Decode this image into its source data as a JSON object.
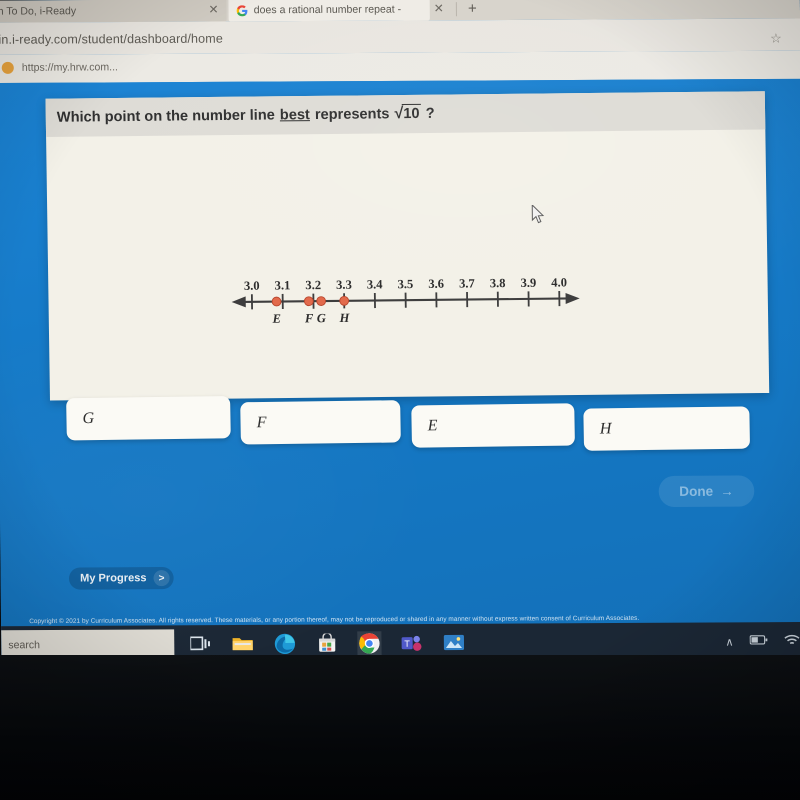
{
  "browser": {
    "tabs": [
      {
        "title": "Math To Do, i-Ready",
        "favicon": "iready-icon",
        "active": false
      },
      {
        "title": "does a rational number repeat -",
        "favicon": "google-g-icon",
        "active": true
      }
    ],
    "new_tab_label": "+",
    "close_label": "✕",
    "url": "gin.i-ready.com/student/dashboard/home",
    "bookmark_star": "☆",
    "bookmarks": [
      {
        "label": "https://my.hrw.com...",
        "favicon": "orange-dot-icon"
      }
    ]
  },
  "question": {
    "prefix": "Which point on the number line",
    "emphasis": "best",
    "middle": "represents",
    "radical_sign": "√",
    "radicand": "10",
    "suffix": "?"
  },
  "number_line": {
    "tick_labels": [
      "3.0",
      "3.1",
      "3.2",
      "3.3",
      "3.4",
      "3.5",
      "3.6",
      "3.7",
      "3.8",
      "3.9",
      "4.0"
    ],
    "tick_values": [
      3.0,
      3.1,
      3.2,
      3.3,
      3.4,
      3.5,
      3.6,
      3.7,
      3.8,
      3.9,
      4.0
    ],
    "axis_min": 2.96,
    "axis_max": 4.04,
    "left_arrow": true,
    "right_arrow": true,
    "point_color": "#e2694a",
    "axis_color": "#3c3c3c",
    "points": [
      {
        "label": "E",
        "value": 3.08
      },
      {
        "label": "F",
        "value": 3.185
      },
      {
        "label": "G",
        "value": 3.225
      },
      {
        "label": "H",
        "value": 3.3
      }
    ]
  },
  "choices": [
    {
      "label": "G"
    },
    {
      "label": "F"
    },
    {
      "label": "E"
    },
    {
      "label": "H"
    }
  ],
  "done_button": {
    "label": "Done",
    "arrow": "→"
  },
  "progress_button": {
    "label": "My Progress",
    "chevron": ">"
  },
  "copyright": "Copyright © 2021 by Curriculum Associates. All rights reserved. These materials, or any portion thereof, may not be reproduced or shared in any manner without express written consent of Curriculum Associates.",
  "taskbar": {
    "search_placeholder": "search",
    "icons": [
      {
        "name": "task-view-icon"
      },
      {
        "name": "file-explorer-icon"
      },
      {
        "name": "microsoft-edge-icon"
      },
      {
        "name": "microsoft-store-icon"
      },
      {
        "name": "google-chrome-icon"
      },
      {
        "name": "microsoft-teams-icon"
      },
      {
        "name": "photos-icon"
      }
    ],
    "tray": [
      {
        "name": "show-hidden-icons-chevron",
        "glyph": "∧"
      },
      {
        "name": "battery-icon"
      },
      {
        "name": "wifi-icon"
      }
    ]
  },
  "colors": {
    "page_blue": "#1578c8",
    "card_cream": "#f3f1e8",
    "card_header_grey": "#dedcd6",
    "point_orange": "#e2694a",
    "taskbar_navy": "#1b2735"
  }
}
